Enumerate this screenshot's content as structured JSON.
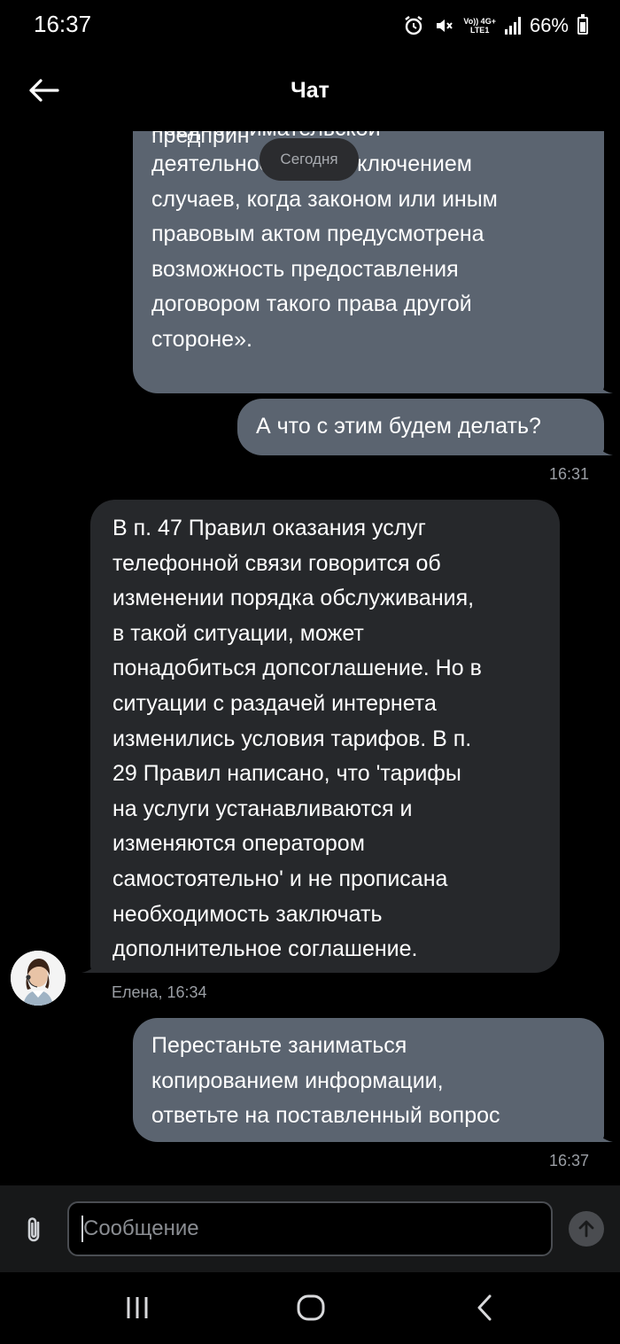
{
  "status_bar": {
    "time": "16:37",
    "network_top": "Vo)) 4G+",
    "network_bottom": "LTE1",
    "battery": "66%",
    "battery_level": 0.66,
    "icons": [
      "alarm-icon",
      "mute-icon",
      "volte-icon",
      "signal-icon",
      "battery-icon"
    ]
  },
  "header": {
    "title": "Чат",
    "back_icon": "arrow-left-icon"
  },
  "date_separator": "Сегодня",
  "messages": [
    {
      "direction": "out",
      "lines": [
        "предпринимательской",
        "деятельности, за исключением",
        "случаев, когда законом или иным",
        "правовым актом предусмотрена",
        "возможность предоставления",
        "договором такого права другой",
        "стороне»."
      ]
    },
    {
      "direction": "out",
      "lines": [
        "А что с этим будем делать?"
      ],
      "time": "16:31"
    },
    {
      "direction": "in",
      "lines": [
        "В п. 47 Правил оказания услуг",
        "телефонной связи говорится об",
        "изменении порядка обслуживания,",
        "в такой ситуации, может",
        "понадобиться допсоглашение. Но в",
        "ситуации с раздачей интернета",
        "изменились условия тарифов. В п.",
        "29 Правил написано, что 'тарифы",
        "на услуги устанавливаются и",
        "изменяются оператором",
        "самостоятельно' и не прописана",
        "необходимость заключать",
        "дополнительное соглашение."
      ],
      "sender_time": "Елена, 16:34"
    },
    {
      "direction": "out",
      "lines": [
        "Перестаньте заниматься",
        "копированием информации,",
        "ответьте на поставленный вопрос"
      ],
      "time": "16:37"
    }
  ],
  "composer": {
    "placeholder": "Сообщение",
    "attach_icon": "paperclip-icon",
    "send_icon": "arrow-up-icon"
  },
  "navbar": {
    "icons": [
      "recent-apps-icon",
      "home-icon",
      "back-icon"
    ]
  },
  "colors": {
    "background": "#000000",
    "bubble_out": "#5b6470",
    "bubble_in": "#26282b",
    "timestamp": "#9a9ea4"
  }
}
